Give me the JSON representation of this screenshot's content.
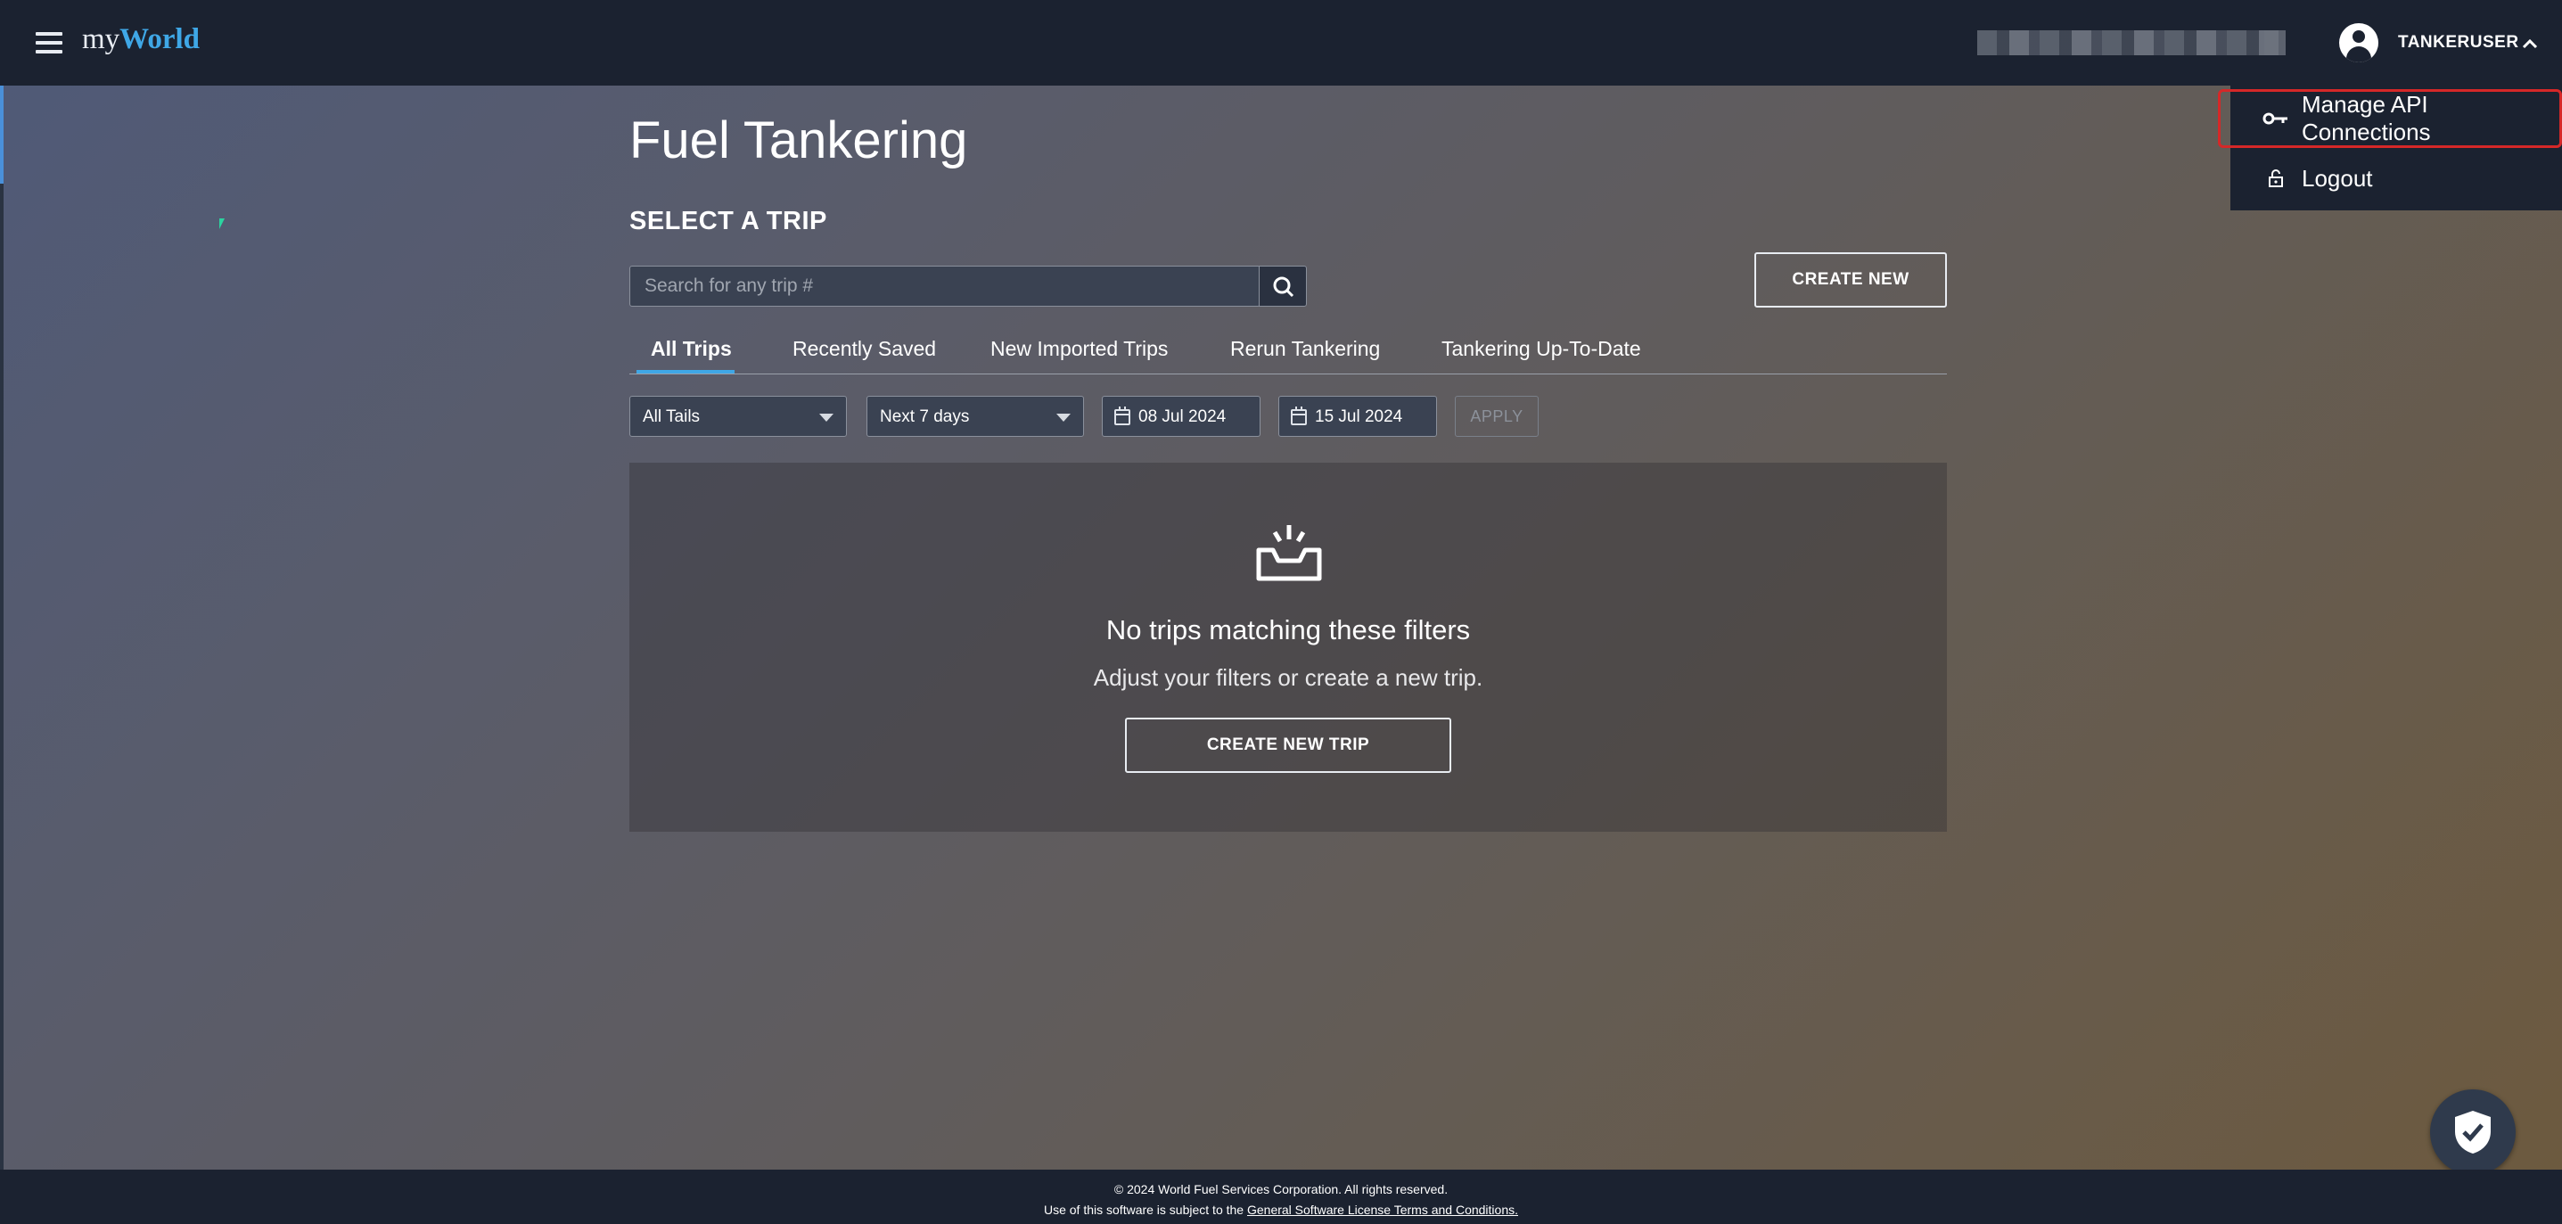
{
  "header": {
    "logo_prefix": "my",
    "logo_suffix": "World",
    "username": "TANKERUSER"
  },
  "user_menu": {
    "items": [
      {
        "label": "Manage API Connections",
        "icon": "key-icon"
      },
      {
        "label": "Logout",
        "icon": "lock-icon"
      }
    ]
  },
  "main": {
    "title": "Fuel Tankering",
    "section_title": "SELECT A TRIP",
    "search_placeholder": "Search for any trip #",
    "create_new_label": "CREATE NEW",
    "tabs": [
      {
        "label": "All Trips",
        "active": true
      },
      {
        "label": "Recently Saved",
        "active": false
      },
      {
        "label": "New Imported Trips",
        "active": false
      },
      {
        "label": "Rerun Tankering",
        "active": false
      },
      {
        "label": "Tankering Up-To-Date",
        "active": false
      }
    ],
    "filters": {
      "tails": "All Tails",
      "range": "Next 7 days",
      "start_date": "08 Jul 2024",
      "end_date": "15 Jul 2024",
      "apply_label": "APPLY"
    },
    "empty_state": {
      "title": "No trips matching these filters",
      "subtitle": "Adjust your filters or create a new trip.",
      "button_label": "CREATE NEW TRIP"
    }
  },
  "footer": {
    "copyright": "© 2024 World Fuel Services Corporation. All rights reserved.",
    "license_prefix": "Use of this software is subject to the",
    "license_link": "General Software License Terms and Conditions."
  },
  "colors": {
    "topbar": "#1b2230",
    "accent": "#3fa7e6",
    "highlight_border": "#d62828"
  }
}
